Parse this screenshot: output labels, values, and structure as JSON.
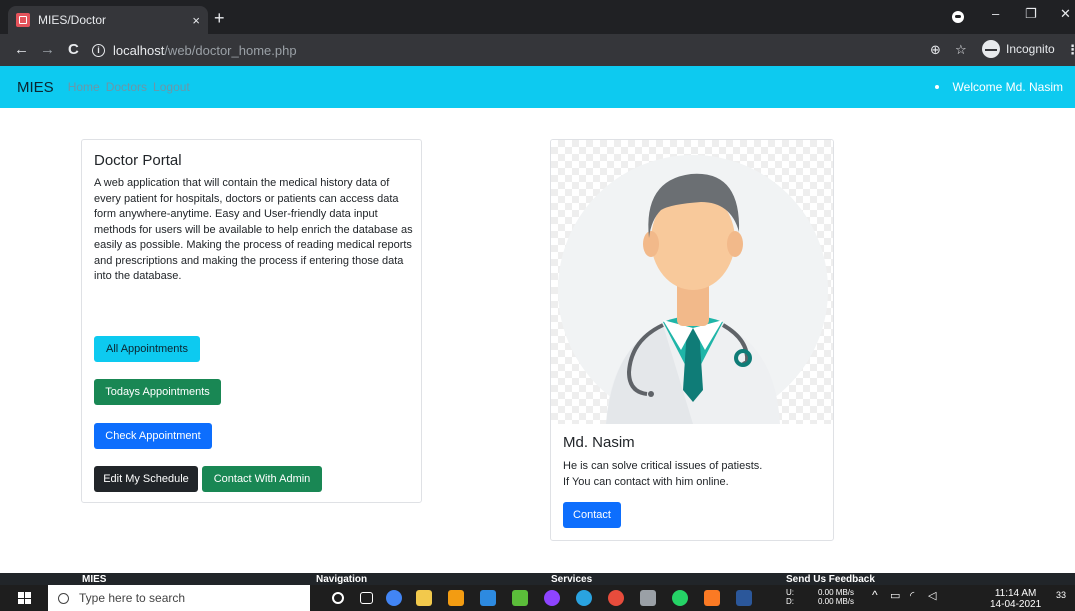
{
  "browser": {
    "tab_title": "MIES/Doctor",
    "tab_close": "×",
    "new_tab": "+",
    "url_host": "localhost",
    "url_path": "/web/doctor_home.php",
    "incognito_label": "Incognito",
    "back": "←",
    "forward": "→",
    "reload": "C",
    "minimize": "–",
    "restore": "❐",
    "close": "✕",
    "zoom": "⊕",
    "star": "☆",
    "menu": "⋮"
  },
  "site_nav": {
    "brand": "MIES",
    "links": [
      "Home",
      "Doctors",
      "Logout"
    ],
    "welcome": "Welcome Md. Nasim"
  },
  "portal": {
    "title": "Doctor Portal",
    "description": "A web application that will contain the medical history data of every patient for hospitals, doctors or patients can access data form anywhere-anytime. Easy and User-friendly data input methods for users will be available to help enrich the database as easily as possible. Making the process of reading medical reports and prescriptions and making the process if entering those data into the database.",
    "buttons": {
      "all_appointments": "All Appointments",
      "todays_appointments": "Todays Appointments",
      "check_appointment": "Check Appointment",
      "edit_schedule": "Edit My Schedule",
      "contact_admin": "Contact With Admin"
    }
  },
  "doctor_card": {
    "name": "Md. Nasim",
    "line1": "He is can solve critical issues of patiests.",
    "line2": "If You can contact with him online.",
    "contact_button": "Contact"
  },
  "footer": {
    "col1": "MIES",
    "col2": "Navigation",
    "col3": "Services",
    "col4": "Send Us Feedback"
  },
  "taskbar": {
    "search_placeholder": "Type here to search",
    "net_up": "0.00 MB/s",
    "net_down": "0.00 MB/s",
    "net_u": "U:",
    "net_d": "D:",
    "time": "11:14 AM",
    "date": "14-04-2021",
    "notif_count": "33"
  },
  "colors": {
    "nav_bg": "#0dcaf0",
    "info": "#0dcaf0",
    "success": "#198754",
    "primary": "#0d6efd",
    "dark": "#212529"
  }
}
